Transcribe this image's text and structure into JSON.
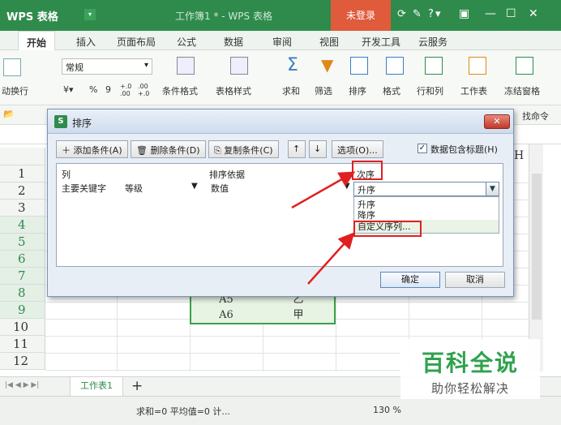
{
  "titlebar": {
    "app_name": "WPS 表格",
    "document_title": "工作簿1 * - WPS 表格",
    "login_label": "未登录",
    "icons": [
      "sync-icon",
      "shirt-icon",
      "help-icon"
    ]
  },
  "menu": {
    "tabs": [
      "开始",
      "插入",
      "页面布局",
      "公式",
      "数据",
      "审阅",
      "视图",
      "开发工具",
      "云服务"
    ]
  },
  "ribbon": {
    "wrap_label": "动换行",
    "number_format": "常规",
    "percent": "%",
    "comma": "9",
    "dec_inc": "+.0 .00",
    "dec_dec": ".00 +.0",
    "cond_format": "条件格式",
    "table_style": "表格样式",
    "sum": "求和",
    "filter": "筛选",
    "sort": "排序",
    "format": "格式",
    "row_col": "行和列",
    "worksheet": "工作表",
    "freeze": "冻结窗格",
    "find_cmd": "找命令"
  },
  "sheet": {
    "row_numbers": [
      "1",
      "2",
      "3",
      "4",
      "5",
      "6",
      "7",
      "8",
      "9",
      "10",
      "11",
      "12"
    ],
    "col_h": "H",
    "cells": [
      [
        "A5",
        "乙"
      ],
      [
        "A6",
        "甲"
      ]
    ]
  },
  "sheetbar": {
    "tab_name": "工作表1",
    "add": "+"
  },
  "statusbar": {
    "text": "求和=0  平均值=0  计...",
    "zoom": "130 %"
  },
  "dialog": {
    "title": "排序",
    "close": "✕",
    "add_condition": "添加条件(A)",
    "delete_condition": "删除条件(D)",
    "copy_condition": "复制条件(C)",
    "up": "↑",
    "down": "↓",
    "options": "选项(O)...",
    "has_header_checked": true,
    "has_header_label": "数据包含标题(H)",
    "col_header": "列",
    "basis_header": "排序依据",
    "order_header": "次序",
    "row_label": "主要关键字",
    "key_value": "等级",
    "basis_value": "数值",
    "order_value": "升序",
    "order_options": [
      "升序",
      "降序",
      "自定义序列..."
    ],
    "ok": "确定",
    "cancel": "取消"
  },
  "watermark": {
    "title": "百科全说",
    "subtitle": "助你轻松解决"
  },
  "colors": {
    "wps_green": "#2f8b4c",
    "login_red": "#e05a3c",
    "annotation_red": "#e02020",
    "watermark_green": "#2fa24e"
  }
}
